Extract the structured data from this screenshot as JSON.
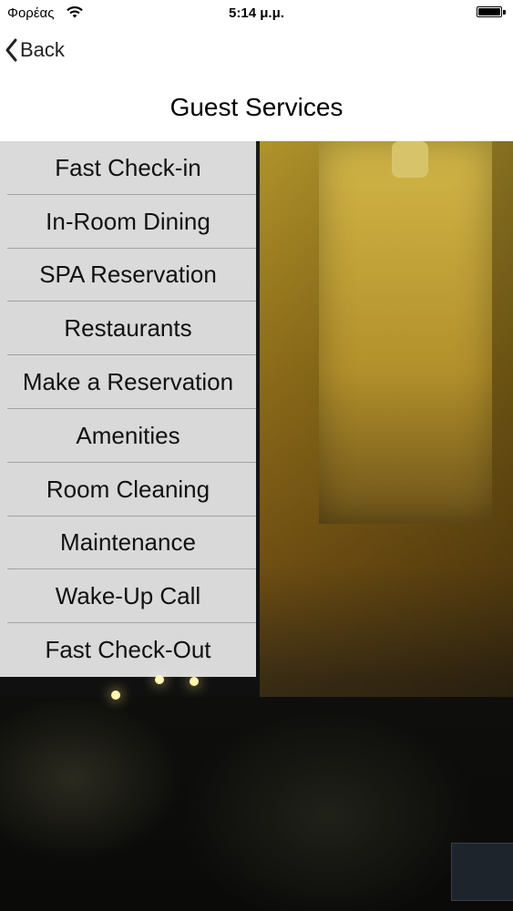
{
  "status_bar": {
    "carrier": "Φορέας",
    "time": "5:14 μ.μ."
  },
  "nav": {
    "back_label": "Back",
    "title": "Guest Services"
  },
  "menu": {
    "items": [
      {
        "label": "Fast Check-in"
      },
      {
        "label": "In-Room Dining"
      },
      {
        "label": "SPA Reservation"
      },
      {
        "label": "Restaurants"
      },
      {
        "label": "Make a Reservation"
      },
      {
        "label": "Amenities"
      },
      {
        "label": "Room Cleaning"
      },
      {
        "label": "Maintenance"
      },
      {
        "label": "Wake-Up Call"
      },
      {
        "label": "Fast Check-Out"
      }
    ]
  },
  "background": {
    "image": "night-hotel-tower-photo"
  },
  "icons": {
    "wifi": "wifi-icon",
    "battery": "battery-icon",
    "back": "chevron-left-icon"
  }
}
